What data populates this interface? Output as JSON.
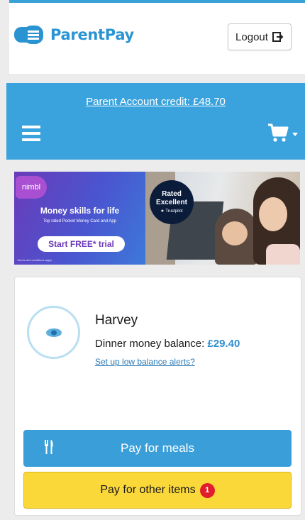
{
  "header": {
    "brand_name": "ParentPay",
    "logout_label": "Logout"
  },
  "account_bar": {
    "credit_text": "Parent Account credit: £48.70"
  },
  "banner": {
    "brand": "nimbl",
    "title": "Money skills for life",
    "subtitle": "Top rated Pocket Money Card and App",
    "cta": "Start FREE* trial",
    "terms": "*terms and conditions apply",
    "rating_line1": "Rated",
    "rating_line2": "Excellent",
    "rating_source": "★ Trustpilot"
  },
  "child_card": {
    "name": "Harvey",
    "balance_label": "Dinner money balance:",
    "balance_value": "£29.40",
    "alerts_link": "Set up low balance alerts?",
    "pay_meals_label": "Pay for meals",
    "pay_other_label": "Pay for other items",
    "other_items_count": "1"
  },
  "colors": {
    "brand_blue": "#3aa3dd",
    "primary_button": "#3a9fd9",
    "secondary_button": "#fbd83a",
    "badge_red": "#e21d2b"
  }
}
